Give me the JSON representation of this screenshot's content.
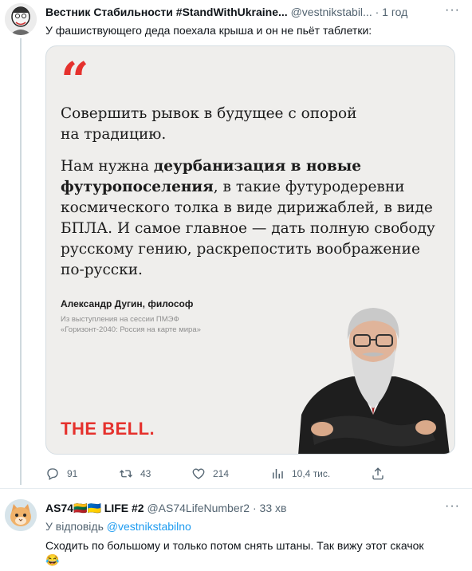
{
  "tweet1": {
    "author_name": "Вестник Стабильности #StandWithUkraine...",
    "handle": "@vestnikstabil...",
    "separator": "·",
    "time": "1 год",
    "text": "У фашиствующего деда поехала крыша и он не пьёт таблетки:",
    "quote_card": {
      "quote_mark": "“",
      "lead": "Совершить рывок в будущее с опорой на традицию.",
      "body_pre": "Нам нужна ",
      "body_bold": "деурбанизация в новые футуропоселения",
      "body_post": ", в такие футуродеревни космического толка в виде дирижаблей, в виде БПЛА. И самое главное — дать полную свободу русскому гению, раскрепостить воображение по-русски.",
      "author": "Александр Дугин, философ",
      "source_line1": "Из выступления на сессии ПМЭФ",
      "source_line2": "«Горизонт-2040: Россия на карте мира»",
      "brand": "THE BELL."
    },
    "actions": {
      "replies": "91",
      "retweets": "43",
      "likes": "214",
      "views": "10,4 тис."
    }
  },
  "tweet2": {
    "author_name": "AS74🇱🇹🇺🇦 LIFE #2",
    "handle": "@AS74LifeNumber2",
    "separator": "·",
    "time": "33 хв",
    "reply_prefix": "У відповідь ",
    "reply_handle": "@vestnikstabilno",
    "text": "Сходить по большому и только потом снять штаны. Так вижу этот скачок",
    "emoji": "😂"
  },
  "icons": [
    "reply-icon",
    "retweet-icon",
    "like-icon",
    "views-icon",
    "share-icon",
    "more-icon"
  ],
  "colors": {
    "accent_red": "#e5312d",
    "link_blue": "#1d9bf0",
    "muted": "#536471"
  }
}
